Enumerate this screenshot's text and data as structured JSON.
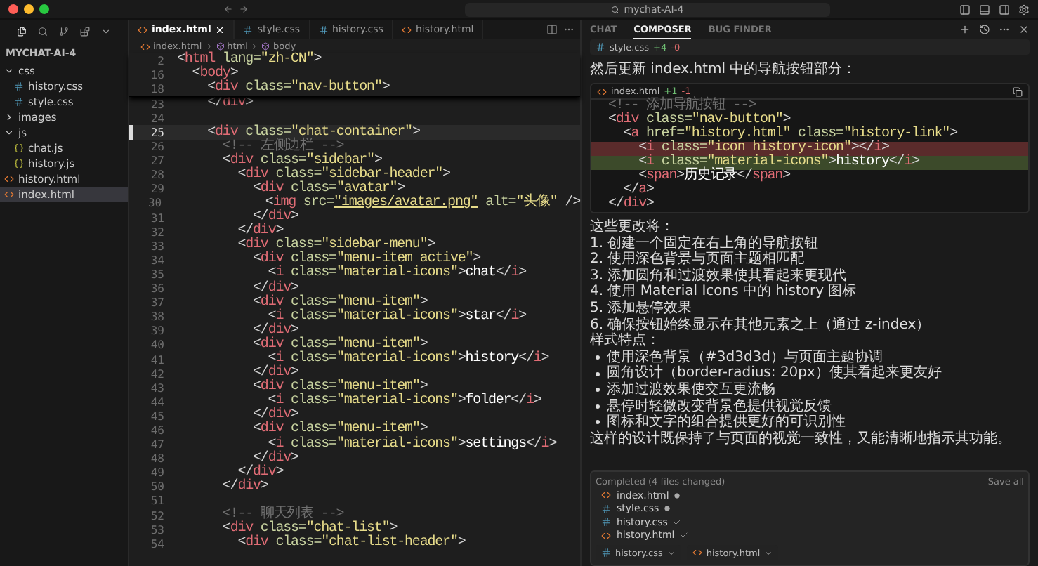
{
  "title_bar": {
    "search": "mychat-AI-4"
  },
  "explorer": {
    "title": "MYCHAT-AI-4",
    "items": [
      {
        "name": "css",
        "kind": "folder",
        "expanded": true,
        "selected": false,
        "children": [
          {
            "name": "history.css",
            "kind": "css",
            "selected": false
          },
          {
            "name": "style.css",
            "kind": "css",
            "selected": false
          }
        ]
      },
      {
        "name": "images",
        "kind": "folder",
        "expanded": false,
        "selected": false
      },
      {
        "name": "js",
        "kind": "folder",
        "expanded": true,
        "selected": false,
        "children": [
          {
            "name": "chat.js",
            "kind": "js",
            "selected": false
          },
          {
            "name": "history.js",
            "kind": "js",
            "selected": false
          }
        ]
      },
      {
        "name": "history.html",
        "kind": "html",
        "selected": false
      },
      {
        "name": "index.html",
        "kind": "html",
        "selected": true
      }
    ]
  },
  "editor": {
    "tabs": [
      {
        "label": "index.html",
        "kind": "html",
        "selected": true
      },
      {
        "label": "style.css",
        "kind": "css",
        "selected": false
      },
      {
        "label": "history.css",
        "kind": "css",
        "selected": false
      },
      {
        "label": "history.html",
        "kind": "html",
        "selected": false
      }
    ],
    "breadcrumb": [
      {
        "text": "index.html",
        "kind": "file"
      },
      {
        "text": "html",
        "kind": "element"
      },
      {
        "text": "body",
        "kind": "element"
      }
    ],
    "sticky_lines": [
      {
        "num": "2",
        "tokens": [
          {
            "kind": "punct",
            "text": "<"
          },
          {
            "kind": "tag",
            "text": "html"
          },
          {
            "kind": "attr",
            "text": " lang="
          },
          {
            "kind": "string",
            "text": "\"zh-CN\""
          },
          {
            "kind": "punct",
            "text": ">"
          }
        ]
      },
      {
        "num": "16",
        "tokens": [
          {
            "kind": "punct",
            "text": "  <"
          },
          {
            "kind": "tag",
            "text": "body"
          },
          {
            "kind": "punct",
            "text": ">"
          }
        ]
      },
      {
        "num": "18",
        "tokens": [
          {
            "kind": "punct",
            "text": "    <"
          },
          {
            "kind": "tag",
            "text": "div"
          },
          {
            "kind": "attr",
            "text": " class="
          },
          {
            "kind": "string",
            "text": "\"nav-button\""
          },
          {
            "kind": "punct",
            "text": ">"
          }
        ]
      }
    ],
    "lines": [
      {
        "num": "23",
        "current": false,
        "tokens": [
          {
            "kind": "punct",
            "text": "    </"
          },
          {
            "kind": "tag",
            "text": "div"
          },
          {
            "kind": "punct",
            "text": ">"
          }
        ]
      },
      {
        "num": "24",
        "current": false
      },
      {
        "num": "25",
        "current": true,
        "tokens": [
          {
            "kind": "punct",
            "text": "    <"
          },
          {
            "kind": "tag",
            "text": "div"
          },
          {
            "kind": "attr",
            "text": " class="
          },
          {
            "kind": "string",
            "text": "\"chat-container\""
          },
          {
            "kind": "punct",
            "text": ">"
          }
        ]
      },
      {
        "num": "26",
        "current": false,
        "tokens": [
          {
            "kind": "comment",
            "text": "      <!-- 左侧边栏 -->"
          }
        ]
      },
      {
        "num": "27",
        "current": false,
        "tokens": [
          {
            "kind": "punct",
            "text": "      <"
          },
          {
            "kind": "tag",
            "text": "div"
          },
          {
            "kind": "attr",
            "text": " class="
          },
          {
            "kind": "string",
            "text": "\"sidebar\""
          },
          {
            "kind": "punct",
            "text": ">"
          }
        ]
      },
      {
        "num": "28",
        "current": false,
        "tokens": [
          {
            "kind": "punct",
            "text": "        <"
          },
          {
            "kind": "tag",
            "text": "div"
          },
          {
            "kind": "attr",
            "text": " class="
          },
          {
            "kind": "string",
            "text": "\"sidebar-header\""
          },
          {
            "kind": "punct",
            "text": ">"
          }
        ]
      },
      {
        "num": "29",
        "current": false,
        "tokens": [
          {
            "kind": "punct",
            "text": "          <"
          },
          {
            "kind": "tag",
            "text": "div"
          },
          {
            "kind": "attr",
            "text": " class="
          },
          {
            "kind": "string",
            "text": "\"avatar\""
          },
          {
            "kind": "punct",
            "text": ">"
          }
        ]
      },
      {
        "num": "30",
        "current": false,
        "tokens": [
          {
            "kind": "punct",
            "text": "            <"
          },
          {
            "kind": "tag",
            "text": "img"
          },
          {
            "kind": "attr",
            "text": " src="
          },
          {
            "kind": "link",
            "text": "\"images/avatar.png\""
          },
          {
            "kind": "attr",
            "text": " alt="
          },
          {
            "kind": "string",
            "text": "\"头像\""
          },
          {
            "kind": "punct",
            "text": " />"
          }
        ]
      },
      {
        "num": "31",
        "current": false,
        "tokens": [
          {
            "kind": "punct",
            "text": "          </"
          },
          {
            "kind": "tag",
            "text": "div"
          },
          {
            "kind": "punct",
            "text": ">"
          }
        ]
      },
      {
        "num": "32",
        "current": false,
        "tokens": [
          {
            "kind": "punct",
            "text": "        </"
          },
          {
            "kind": "tag",
            "text": "div"
          },
          {
            "kind": "punct",
            "text": ">"
          }
        ]
      },
      {
        "num": "33",
        "current": false,
        "tokens": [
          {
            "kind": "punct",
            "text": "        <"
          },
          {
            "kind": "tag",
            "text": "div"
          },
          {
            "kind": "attr",
            "text": " class="
          },
          {
            "kind": "string",
            "text": "\"sidebar-menu\""
          },
          {
            "kind": "punct",
            "text": ">"
          }
        ]
      },
      {
        "num": "34",
        "current": false,
        "tokens": [
          {
            "kind": "punct",
            "text": "          <"
          },
          {
            "kind": "tag",
            "text": "div"
          },
          {
            "kind": "attr",
            "text": " class="
          },
          {
            "kind": "string",
            "text": "\"menu-item active\""
          },
          {
            "kind": "punct",
            "text": ">"
          }
        ]
      },
      {
        "num": "35",
        "current": false,
        "tokens": [
          {
            "kind": "punct",
            "text": "            <"
          },
          {
            "kind": "tag",
            "text": "i"
          },
          {
            "kind": "attr",
            "text": " class="
          },
          {
            "kind": "string",
            "text": "\"material-icons\""
          },
          {
            "kind": "punct",
            "text": ">"
          },
          {
            "kind": "text",
            "text": "chat"
          },
          {
            "kind": "punct",
            "text": "</"
          },
          {
            "kind": "tag",
            "text": "i"
          },
          {
            "kind": "punct",
            "text": ">"
          }
        ]
      },
      {
        "num": "36",
        "current": false,
        "tokens": [
          {
            "kind": "punct",
            "text": "          </"
          },
          {
            "kind": "tag",
            "text": "div"
          },
          {
            "kind": "punct",
            "text": ">"
          }
        ]
      },
      {
        "num": "37",
        "current": false,
        "tokens": [
          {
            "kind": "punct",
            "text": "          <"
          },
          {
            "kind": "tag",
            "text": "div"
          },
          {
            "kind": "attr",
            "text": " class="
          },
          {
            "kind": "string",
            "text": "\"menu-item\""
          },
          {
            "kind": "punct",
            "text": ">"
          }
        ]
      },
      {
        "num": "38",
        "current": false,
        "tokens": [
          {
            "kind": "punct",
            "text": "            <"
          },
          {
            "kind": "tag",
            "text": "i"
          },
          {
            "kind": "attr",
            "text": " class="
          },
          {
            "kind": "string",
            "text": "\"material-icons\""
          },
          {
            "kind": "punct",
            "text": ">"
          },
          {
            "kind": "text",
            "text": "star"
          },
          {
            "kind": "punct",
            "text": "</"
          },
          {
            "kind": "tag",
            "text": "i"
          },
          {
            "kind": "punct",
            "text": ">"
          }
        ]
      },
      {
        "num": "39",
        "current": false,
        "tokens": [
          {
            "kind": "punct",
            "text": "          </"
          },
          {
            "kind": "tag",
            "text": "div"
          },
          {
            "kind": "punct",
            "text": ">"
          }
        ]
      },
      {
        "num": "40",
        "current": false,
        "tokens": [
          {
            "kind": "punct",
            "text": "          <"
          },
          {
            "kind": "tag",
            "text": "div"
          },
          {
            "kind": "attr",
            "text": " class="
          },
          {
            "kind": "string",
            "text": "\"menu-item\""
          },
          {
            "kind": "punct",
            "text": ">"
          }
        ]
      },
      {
        "num": "41",
        "current": false,
        "tokens": [
          {
            "kind": "punct",
            "text": "            <"
          },
          {
            "kind": "tag",
            "text": "i"
          },
          {
            "kind": "attr",
            "text": " class="
          },
          {
            "kind": "string",
            "text": "\"material-icons\""
          },
          {
            "kind": "punct",
            "text": ">"
          },
          {
            "kind": "text",
            "text": "history"
          },
          {
            "kind": "punct",
            "text": "</"
          },
          {
            "kind": "tag",
            "text": "i"
          },
          {
            "kind": "punct",
            "text": ">"
          }
        ]
      },
      {
        "num": "42",
        "current": false,
        "tokens": [
          {
            "kind": "punct",
            "text": "          </"
          },
          {
            "kind": "tag",
            "text": "div"
          },
          {
            "kind": "punct",
            "text": ">"
          }
        ]
      },
      {
        "num": "43",
        "current": false,
        "tokens": [
          {
            "kind": "punct",
            "text": "          <"
          },
          {
            "kind": "tag",
            "text": "div"
          },
          {
            "kind": "attr",
            "text": " class="
          },
          {
            "kind": "string",
            "text": "\"menu-item\""
          },
          {
            "kind": "punct",
            "text": ">"
          }
        ]
      },
      {
        "num": "44",
        "current": false,
        "tokens": [
          {
            "kind": "punct",
            "text": "            <"
          },
          {
            "kind": "tag",
            "text": "i"
          },
          {
            "kind": "attr",
            "text": " class="
          },
          {
            "kind": "string",
            "text": "\"material-icons\""
          },
          {
            "kind": "punct",
            "text": ">"
          },
          {
            "kind": "text",
            "text": "folder"
          },
          {
            "kind": "punct",
            "text": "</"
          },
          {
            "kind": "tag",
            "text": "i"
          },
          {
            "kind": "punct",
            "text": ">"
          }
        ]
      },
      {
        "num": "45",
        "current": false,
        "tokens": [
          {
            "kind": "punct",
            "text": "          </"
          },
          {
            "kind": "tag",
            "text": "div"
          },
          {
            "kind": "punct",
            "text": ">"
          }
        ]
      },
      {
        "num": "46",
        "current": false,
        "tokens": [
          {
            "kind": "punct",
            "text": "          <"
          },
          {
            "kind": "tag",
            "text": "div"
          },
          {
            "kind": "attr",
            "text": " class="
          },
          {
            "kind": "string",
            "text": "\"menu-item\""
          },
          {
            "kind": "punct",
            "text": ">"
          }
        ]
      },
      {
        "num": "47",
        "current": false,
        "tokens": [
          {
            "kind": "punct",
            "text": "            <"
          },
          {
            "kind": "tag",
            "text": "i"
          },
          {
            "kind": "attr",
            "text": " class="
          },
          {
            "kind": "string",
            "text": "\"material-icons\""
          },
          {
            "kind": "punct",
            "text": ">"
          },
          {
            "kind": "text",
            "text": "settings"
          },
          {
            "kind": "punct",
            "text": "</"
          },
          {
            "kind": "tag",
            "text": "i"
          },
          {
            "kind": "punct",
            "text": ">"
          }
        ]
      },
      {
        "num": "48",
        "current": false,
        "tokens": [
          {
            "kind": "punct",
            "text": "          </"
          },
          {
            "kind": "tag",
            "text": "div"
          },
          {
            "kind": "punct",
            "text": ">"
          }
        ]
      },
      {
        "num": "49",
        "current": false,
        "tokens": [
          {
            "kind": "punct",
            "text": "        </"
          },
          {
            "kind": "tag",
            "text": "div"
          },
          {
            "kind": "punct",
            "text": ">"
          }
        ]
      },
      {
        "num": "50",
        "current": false,
        "tokens": [
          {
            "kind": "punct",
            "text": "      </"
          },
          {
            "kind": "tag",
            "text": "div"
          },
          {
            "kind": "punct",
            "text": ">"
          }
        ]
      },
      {
        "num": "51",
        "current": false
      },
      {
        "num": "52",
        "current": false,
        "tokens": [
          {
            "kind": "comment",
            "text": "      <!-- 聊天列表 -->"
          }
        ]
      },
      {
        "num": "53",
        "current": false,
        "tokens": [
          {
            "kind": "punct",
            "text": "      <"
          },
          {
            "kind": "tag",
            "text": "div"
          },
          {
            "kind": "attr",
            "text": " class="
          },
          {
            "kind": "string",
            "text": "\"chat-list\""
          },
          {
            "kind": "punct",
            "text": ">"
          }
        ]
      },
      {
        "num": "54",
        "current": false,
        "tokens": [
          {
            "kind": "punct",
            "text": "        <"
          },
          {
            "kind": "tag",
            "text": "div"
          },
          {
            "kind": "attr",
            "text": " class="
          },
          {
            "kind": "string",
            "text": "\"chat-list-header\""
          },
          {
            "kind": "punct",
            "text": ">"
          }
        ]
      }
    ]
  },
  "composer": {
    "tabs": [
      {
        "label": "CHAT",
        "selected": false
      },
      {
        "label": "COMPOSER",
        "selected": true
      },
      {
        "label": "BUG FINDER",
        "selected": false
      }
    ],
    "file_chip": {
      "name": "style.css",
      "kind": "css",
      "added": "+4",
      "removed": "-0"
    },
    "message": "然后更新 index.html 中的导航按钮部分：",
    "code_block": {
      "file": "index.html",
      "kind": "html",
      "added": "+1",
      "removed": "-1",
      "lines": [
        {
          "removed": false,
          "added": false,
          "tokens": [
            {
              "kind": "comment",
              "text": "<!-- 添加导航按钮 -->"
            }
          ]
        },
        {
          "removed": false,
          "added": false,
          "tokens": [
            {
              "kind": "punct",
              "text": "<"
            },
            {
              "kind": "tag",
              "text": "div"
            },
            {
              "kind": "attr",
              "text": " class="
            },
            {
              "kind": "string",
              "text": "\"nav-button\""
            },
            {
              "kind": "punct",
              "text": ">"
            }
          ]
        },
        {
          "removed": false,
          "added": false,
          "tokens": [
            {
              "kind": "punct",
              "text": "  <"
            },
            {
              "kind": "tag",
              "text": "a"
            },
            {
              "kind": "attr",
              "text": " href="
            },
            {
              "kind": "string",
              "text": "\"history.html\""
            },
            {
              "kind": "attr",
              "text": " class="
            },
            {
              "kind": "string",
              "text": "\"history-link\""
            },
            {
              "kind": "punct",
              "text": ">"
            }
          ]
        },
        {
          "removed": true,
          "added": false,
          "tokens": [
            {
              "kind": "punct",
              "text": "    <"
            },
            {
              "kind": "tag",
              "text": "i"
            },
            {
              "kind": "attr",
              "text": " class="
            },
            {
              "kind": "string",
              "text": "\"icon history-icon\""
            },
            {
              "kind": "punct",
              "text": "></"
            },
            {
              "kind": "tag",
              "text": "i"
            },
            {
              "kind": "punct",
              "text": ">"
            }
          ]
        },
        {
          "removed": false,
          "added": true,
          "tokens": [
            {
              "kind": "punct",
              "text": "    <"
            },
            {
              "kind": "tag",
              "text": "i"
            },
            {
              "kind": "attr",
              "text": " class="
            },
            {
              "kind": "string",
              "text": "\"material-icons\""
            },
            {
              "kind": "punct",
              "text": ">"
            },
            {
              "kind": "text",
              "text": "history"
            },
            {
              "kind": "punct",
              "text": "</"
            },
            {
              "kind": "tag",
              "text": "i"
            },
            {
              "kind": "punct",
              "text": ">"
            }
          ]
        },
        {
          "removed": false,
          "added": false,
          "tokens": [
            {
              "kind": "punct",
              "text": "    <"
            },
            {
              "kind": "tag",
              "text": "span"
            },
            {
              "kind": "punct",
              "text": ">"
            },
            {
              "kind": "text",
              "text": "历史记录"
            },
            {
              "kind": "punct",
              "text": "</"
            },
            {
              "kind": "tag",
              "text": "span"
            },
            {
              "kind": "punct",
              "text": ">"
            }
          ]
        },
        {
          "removed": false,
          "added": false,
          "tokens": [
            {
              "kind": "punct",
              "text": "  </"
            },
            {
              "kind": "tag",
              "text": "a"
            },
            {
              "kind": "punct",
              "text": ">"
            }
          ]
        },
        {
          "removed": false,
          "added": false,
          "tokens": [
            {
              "kind": "punct",
              "text": "</"
            },
            {
              "kind": "tag",
              "text": "div"
            },
            {
              "kind": "punct",
              "text": ">"
            }
          ]
        }
      ]
    },
    "notes": [
      {
        "kind": "paragraph",
        "text": "这些更改将："
      },
      {
        "kind": "paragraph",
        "text": "1. 创建一个固定在右上角的导航按钮"
      },
      {
        "kind": "paragraph",
        "text": "2. 使用深色背景与页面主题相匹配"
      },
      {
        "kind": "paragraph",
        "text": "3. 添加圆角和过渡效果使其看起来更现代"
      },
      {
        "kind": "paragraph",
        "text": "4. 使用 Material Icons 中的 history 图标"
      },
      {
        "kind": "paragraph",
        "text": "5. 添加悬停效果"
      },
      {
        "kind": "paragraph",
        "text": "6. 确保按钮始终显示在其他元素之上（通过 z-index）"
      },
      {
        "kind": "paragraph",
        "text": "样式特点："
      },
      {
        "kind": "bullet",
        "text": "使用深色背景（#3d3d3d）与页面主题协调"
      },
      {
        "kind": "bullet",
        "text": "圆角设计（border-radius: 20px）使其看起来更友好"
      },
      {
        "kind": "bullet",
        "text": "添加过渡效果使交互更流畅"
      },
      {
        "kind": "bullet",
        "text": "悬停时轻微改变背景色提供视觉反馈"
      },
      {
        "kind": "bullet",
        "text": "图标和文字的组合提供更好的可识别性"
      },
      {
        "kind": "paragraph",
        "text": "这样的设计既保持了与页面的视觉一致性，又能清晰地指示其功能。"
      }
    ],
    "completed": {
      "title": "Completed (4 files changed)",
      "action": "Save all",
      "files": [
        {
          "name": "index.html",
          "kind": "html",
          "accepted": false
        },
        {
          "name": "style.css",
          "kind": "css",
          "accepted": false
        },
        {
          "name": "history.css",
          "kind": "css",
          "accepted": true
        },
        {
          "name": "history.html",
          "kind": "html",
          "accepted": true
        }
      ]
    },
    "context_chips": [
      {
        "name": "history.css",
        "kind": "css"
      },
      {
        "name": "history.html",
        "kind": "html"
      }
    ]
  }
}
